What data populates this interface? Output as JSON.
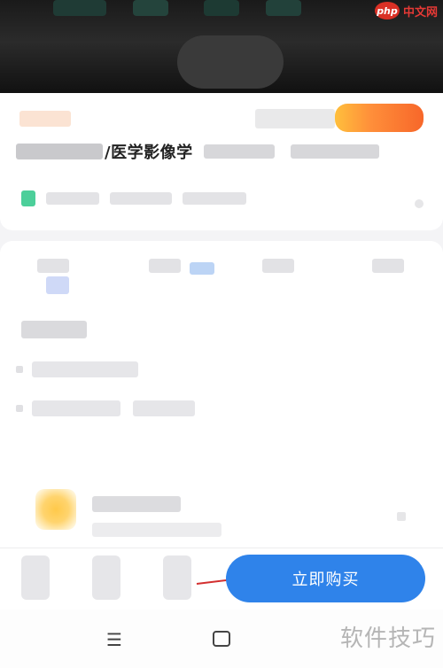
{
  "watermark_top": {
    "logo": "php",
    "text": "中文网"
  },
  "course": {
    "title_suffix": "/医学影像学"
  },
  "purchase": {
    "buy_label": "立即购买"
  },
  "system_nav": {
    "menu_glyph": "☰"
  },
  "watermark_bottom": {
    "text": "软件技巧"
  },
  "colors": {
    "buy_button": "#2f83ea",
    "price_badge": "#f7672a",
    "arrow": "#d32f2f",
    "meta_icon": "#4ccf9a"
  }
}
